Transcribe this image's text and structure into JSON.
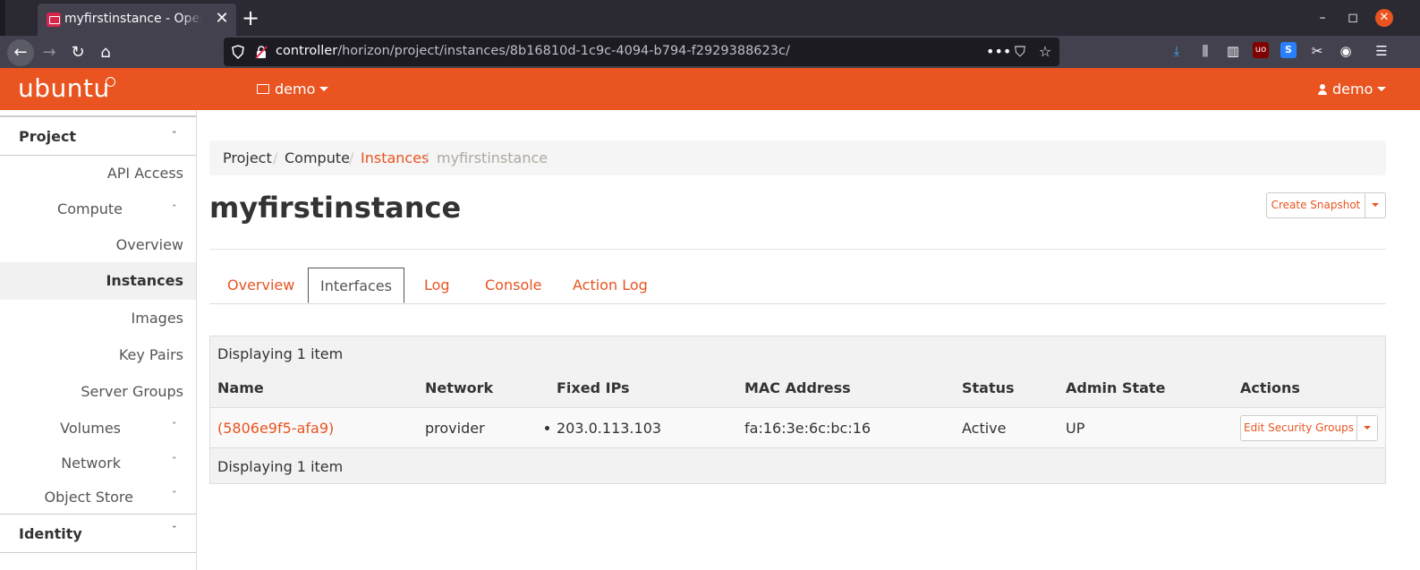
{
  "browser": {
    "tab_title": "myfirstinstance - OpenStack Dashboard",
    "url_host": "controller",
    "url_path": "/horizon/project/instances/8b16810d-1c9c-4094-b794-f2929388623c/"
  },
  "header": {
    "logo": "ubuntu",
    "project": "demo",
    "user": "demo"
  },
  "sidebar": {
    "project_section": "Project",
    "api_access": "API Access",
    "compute": "Compute",
    "overview": "Overview",
    "instances": "Instances",
    "images": "Images",
    "key_pairs": "Key Pairs",
    "server_groups": "Server Groups",
    "volumes": "Volumes",
    "network": "Network",
    "object_store": "Object Store",
    "identity_section": "Identity"
  },
  "breadcrumb": {
    "project": "Project",
    "compute": "Compute",
    "instances": "Instances",
    "current": "myfirstinstance",
    "sep": "/"
  },
  "page": {
    "title": "myfirstinstance",
    "create_snapshot": "Create Snapshot"
  },
  "tabs": {
    "overview": "Overview",
    "interfaces": "Interfaces",
    "log": "Log",
    "console": "Console",
    "action_log": "Action Log"
  },
  "table": {
    "count_top": "Displaying 1 item",
    "count_bottom": "Displaying 1 item",
    "headers": {
      "name": "Name",
      "network": "Network",
      "fixed_ips": "Fixed IPs",
      "mac": "MAC Address",
      "status": "Status",
      "admin_state": "Admin State",
      "actions": "Actions"
    },
    "rows": [
      {
        "name": "(5806e9f5-afa9)",
        "network": "provider",
        "fixed_ip": "203.0.113.103",
        "mac": "fa:16:3e:6c:bc:16",
        "status": "Active",
        "admin_state": "UP",
        "action": "Edit Security Groups"
      }
    ]
  },
  "colors": {
    "accent": "#e95420",
    "chrome_dark": "#2b2a33",
    "chrome_toolbar": "#42414d"
  }
}
